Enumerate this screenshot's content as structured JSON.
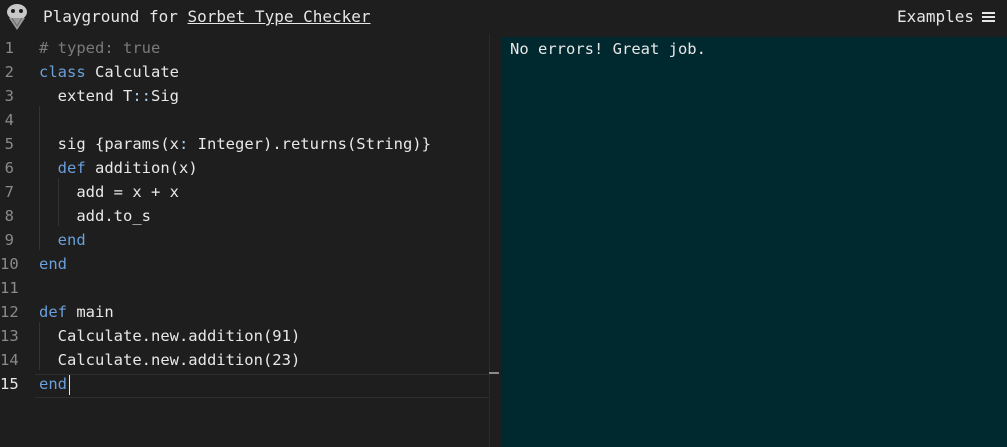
{
  "header": {
    "title_prefix": "Playground for ",
    "title_link": "Sorbet Type Checker",
    "examples_label": "Examples"
  },
  "editor": {
    "lines": [
      {
        "num": "1",
        "segments": [
          {
            "cls": "c-comment",
            "text": "# typed: true"
          }
        ]
      },
      {
        "num": "2",
        "segments": [
          {
            "cls": "c-kw",
            "text": "class"
          },
          {
            "cls": "",
            "text": " Calculate"
          }
        ]
      },
      {
        "num": "3",
        "segments": [
          {
            "cls": "",
            "text": "  extend T"
          },
          {
            "cls": "c-sym",
            "text": "::"
          },
          {
            "cls": "",
            "text": "Sig"
          }
        ]
      },
      {
        "num": "4",
        "segments": []
      },
      {
        "num": "5",
        "segments": [
          {
            "cls": "",
            "text": "  sig {params(x"
          },
          {
            "cls": "c-sym",
            "text": ":"
          },
          {
            "cls": "",
            "text": " Integer).returns(String)}"
          }
        ]
      },
      {
        "num": "6",
        "segments": [
          {
            "cls": "",
            "text": "  "
          },
          {
            "cls": "c-kw",
            "text": "def"
          },
          {
            "cls": "",
            "text": " addition(x)"
          }
        ]
      },
      {
        "num": "7",
        "segments": [
          {
            "cls": "",
            "text": "    add = x + x"
          }
        ]
      },
      {
        "num": "8",
        "segments": [
          {
            "cls": "",
            "text": "    add.to_s"
          }
        ]
      },
      {
        "num": "9",
        "segments": [
          {
            "cls": "",
            "text": "  "
          },
          {
            "cls": "c-kw",
            "text": "end"
          }
        ]
      },
      {
        "num": "10",
        "segments": [
          {
            "cls": "c-kw",
            "text": "end"
          }
        ]
      },
      {
        "num": "11",
        "segments": []
      },
      {
        "num": "12",
        "segments": [
          {
            "cls": "c-kw",
            "text": "def"
          },
          {
            "cls": "",
            "text": " main"
          }
        ]
      },
      {
        "num": "13",
        "segments": [
          {
            "cls": "",
            "text": "  Calculate.new.addition(91)"
          }
        ]
      },
      {
        "num": "14",
        "segments": [
          {
            "cls": "",
            "text": "  Calculate.new.addition(23)"
          }
        ]
      },
      {
        "num": "15",
        "segments": [
          {
            "cls": "c-kw",
            "text": "end"
          }
        ]
      }
    ],
    "active_line": "15"
  },
  "output": {
    "text": "No errors! Great job."
  }
}
